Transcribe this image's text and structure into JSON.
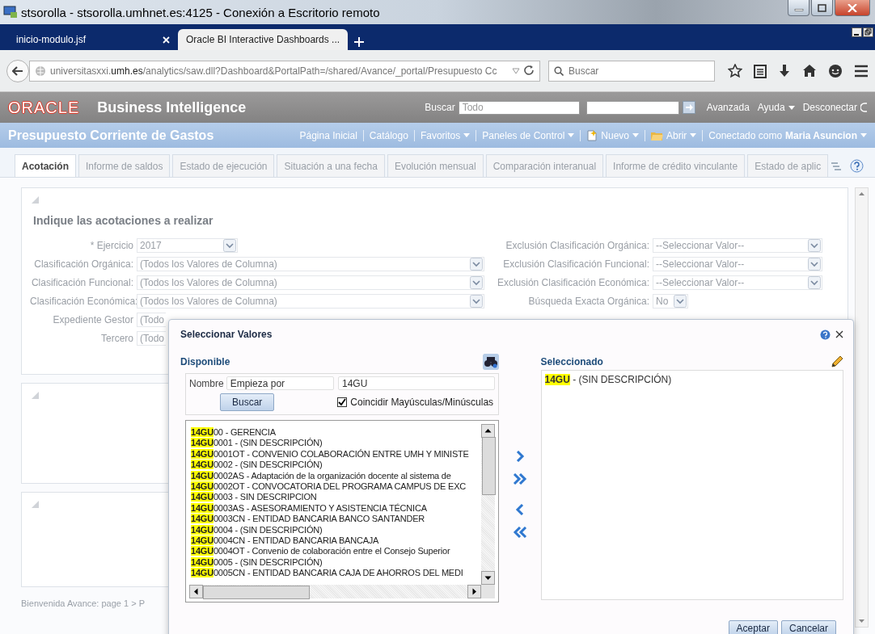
{
  "window": {
    "title": "stsorolla - stsorolla.umhnet.es:4125 - Conexión a Escritorio remoto"
  },
  "browser": {
    "tabs": [
      {
        "label": "inicio-modulo.jsf",
        "selected": false
      },
      {
        "label": "Oracle BI Interactive Dashboards ...",
        "selected": true
      }
    ],
    "url": {
      "host_start": "universitasxxi.",
      "domain": "umh.es",
      "rest": "/analytics/saw.dll?Dashboard&PortalPath=/shared/Avance/_portal/Presupuesto Cc"
    },
    "search": {
      "placeholder": "Buscar"
    }
  },
  "header": {
    "logo": "ORACLE",
    "product": "Business Intelligence",
    "search_label": "Buscar",
    "search_scope": "Todo",
    "links": [
      {
        "label": "Avanzada",
        "menu": false
      },
      {
        "label": "Ayuda",
        "menu": true
      },
      {
        "label": "Desconectar",
        "menu": false
      }
    ]
  },
  "dashboard": {
    "title": "Presupuesto Corriente de Gastos",
    "menu": [
      {
        "label": "Página Inicial",
        "menu": false
      },
      {
        "label": "Catálogo",
        "menu": false
      },
      {
        "label": "Favoritos",
        "menu": true
      },
      {
        "label": "Paneles de Control",
        "menu": true
      },
      {
        "label": "Nuevo",
        "menu": true,
        "kind": "create"
      },
      {
        "label": "Abrir",
        "menu": true,
        "kind": "open"
      }
    ],
    "user": {
      "prefix": "Conectado como",
      "name": "Maria Asuncion"
    }
  },
  "page_tabs": [
    {
      "label": "Acotación",
      "selected": true
    },
    {
      "label": "Informe de saldos",
      "selected": false
    },
    {
      "label": "Estado de ejecución",
      "selected": false
    },
    {
      "label": "Situación a una fecha",
      "selected": false
    },
    {
      "label": "Evolución mensual",
      "selected": false
    },
    {
      "label": "Comparación interanual",
      "selected": false
    },
    {
      "label": "Informe de crédito vinculante",
      "selected": false
    },
    {
      "label": "Estado de aplic",
      "selected": false
    }
  ],
  "prompt": {
    "title": "Indique las acotaciones a realizar",
    "left_fields": [
      {
        "label": "* Ejercicio",
        "value": "2017",
        "kind": "short"
      },
      {
        "label": "Clasificación Orgánica:",
        "value": "(Todos los Valores de Columna)",
        "kind": "long"
      },
      {
        "label": "Clasificación Funcional:",
        "value": "(Todos los Valores de Columna)",
        "kind": "long"
      },
      {
        "label": "Clasificación Económica:",
        "value": "(Todos los Valores de Columna)",
        "kind": "long"
      },
      {
        "label": "Expediente Gestor",
        "value": "(Todo",
        "kind": "cut"
      },
      {
        "label": "Tercero",
        "value": "(Todo",
        "kind": "cut"
      }
    ],
    "right_fields": [
      {
        "label": "Exclusión Clasificación Orgánica:",
        "value": "--Seleccionar Valor--",
        "kind": "long"
      },
      {
        "label": "Exclusión Clasificación Funcional:",
        "value": "--Seleccionar Valor--",
        "kind": "long"
      },
      {
        "label": "Exclusión Clasificación Económica:",
        "value": "--Seleccionar Valor--",
        "kind": "long"
      },
      {
        "label": "Búsqueda Exacta Orgánica:",
        "value": "No",
        "kind": "short"
      }
    ]
  },
  "footer": "Bienvenida Avance: page 1 > P",
  "dialog": {
    "title": "Seleccionar Valores",
    "available": {
      "heading": "Disponible",
      "name_label": "Nombre",
      "operator": "Empieza por",
      "value": "14GU",
      "search_button": "Buscar",
      "match_case": {
        "label": "Coincidir Mayúsculas/Minúsculas",
        "checked": true
      },
      "items": [
        "**14GU**00 - GERENCIA",
        "**14GU**0001 - (SIN DESCRIPCIÓN)",
        "**14GU**0001OT - CONVENIO COLABORACIÓN ENTRE UMH Y MINISTE",
        "**14GU**0002 - (SIN DESCRIPCIÓN)",
        "**14GU**0002AS - Adaptación de la organización docente al sistema de",
        "**14GU**0002OT - CONVOCATORIA DEL PROGRAMA CAMPUS DE EXC",
        "**14GU**0003 - SIN DESCRIPCION",
        "**14GU**0003AS - ASESORAMIENTO Y ASISTENCIA TÉCNICA",
        "**14GU**0003CN - ENTIDAD BANCARIA BANCO SANTANDER",
        "**14GU**0004 - (SIN DESCRIPCIÓN)",
        "**14GU**0004CN - ENTIDAD BANCARIA BANCAJA",
        "**14GU**0004OT - Convenio de colaboración entre el Consejo Superior",
        "**14GU**0005 - (SIN DESCRIPCIÓN)",
        "**14GU**0005CN - ENTIDAD BANCARIA CAJA DE AHORROS DEL MEDI"
      ]
    },
    "selected": {
      "heading": "Seleccionado",
      "items": [
        "**14GU** - (SIN DESCRIPCIÓN)"
      ]
    },
    "buttons": [
      "Aceptar",
      "Cancelar"
    ]
  }
}
